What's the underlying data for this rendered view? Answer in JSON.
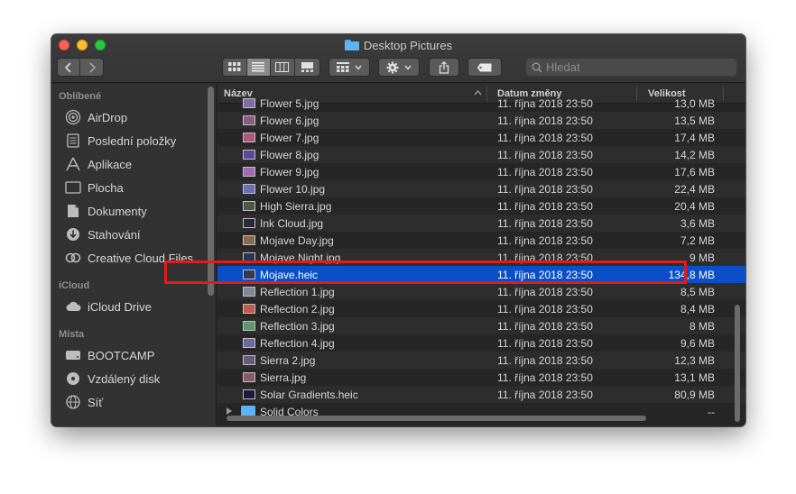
{
  "window": {
    "title": "Desktop Pictures"
  },
  "toolbar": {
    "back_icon": "chevron-left-icon",
    "forward_icon": "chevron-right-icon",
    "view_modes": [
      "icon-view",
      "list-view",
      "column-view",
      "gallery-view"
    ],
    "active_view": "list-view",
    "search_placeholder": "Hledat"
  },
  "sidebar": {
    "sections": [
      {
        "title": "Oblíbené",
        "items": [
          {
            "label": "AirDrop",
            "icon": "airdrop-icon"
          },
          {
            "label": "Poslední položky",
            "icon": "recents-icon"
          },
          {
            "label": "Aplikace",
            "icon": "applications-icon"
          },
          {
            "label": "Plocha",
            "icon": "desktop-icon"
          },
          {
            "label": "Dokumenty",
            "icon": "documents-icon"
          },
          {
            "label": "Stahování",
            "icon": "downloads-icon"
          },
          {
            "label": "Creative Cloud Files",
            "icon": "creative-cloud-icon"
          }
        ]
      },
      {
        "title": "iCloud",
        "items": [
          {
            "label": "iCloud Drive",
            "icon": "cloud-icon"
          }
        ]
      },
      {
        "title": "Místa",
        "items": [
          {
            "label": "BOOTCAMP",
            "icon": "disk-icon"
          },
          {
            "label": "Vzdálený disk",
            "icon": "remote-disc-icon"
          },
          {
            "label": "Síť",
            "icon": "network-icon"
          }
        ]
      }
    ]
  },
  "columns": {
    "name": "Název",
    "date": "Datum změny",
    "size": "Velikost"
  },
  "files": [
    {
      "name": "Flower 5.jpg",
      "date": "11. října 2018 23:50",
      "size": "13,0 MB",
      "thumb": "#7d6fa6"
    },
    {
      "name": "Flower 6.jpg",
      "date": "11. října 2018 23:50",
      "size": "13,5 MB",
      "thumb": "#8a5f7d"
    },
    {
      "name": "Flower 7.jpg",
      "date": "11. října 2018 23:50",
      "size": "17,4 MB",
      "thumb": "#b0577a"
    },
    {
      "name": "Flower 8.jpg",
      "date": "11. října 2018 23:50",
      "size": "14,2 MB",
      "thumb": "#5b4a9a"
    },
    {
      "name": "Flower 9.jpg",
      "date": "11. října 2018 23:50",
      "size": "17,6 MB",
      "thumb": "#a06ab0"
    },
    {
      "name": "Flower 10.jpg",
      "date": "11. října 2018 23:50",
      "size": "22,4 MB",
      "thumb": "#6d6db5"
    },
    {
      "name": "High Sierra.jpg",
      "date": "11. října 2018 23:50",
      "size": "20,4 MB",
      "thumb": "#4a5a4a"
    },
    {
      "name": "Ink Cloud.jpg",
      "date": "11. října 2018 23:50",
      "size": "3,6 MB",
      "thumb": "#2a2a3a"
    },
    {
      "name": "Mojave Day.jpg",
      "date": "11. října 2018 23:50",
      "size": "7,2 MB",
      "thumb": "#8a6a50"
    },
    {
      "name": "Mojave Night.jpg",
      "date": "11. října 2018 23:50",
      "size": "9 MB",
      "thumb": "#2a3550"
    },
    {
      "name": "Mojave.heic",
      "date": "11. října 2018 23:50",
      "size": "134,8 MB",
      "thumb": "#2f3a58",
      "selected": true
    },
    {
      "name": "Reflection 1.jpg",
      "date": "11. října 2018 23:50",
      "size": "8,5 MB",
      "thumb": "#7a8a9a"
    },
    {
      "name": "Reflection 2.jpg",
      "date": "11. října 2018 23:50",
      "size": "8,4 MB",
      "thumb": "#c05a4a"
    },
    {
      "name": "Reflection 3.jpg",
      "date": "11. října 2018 23:50",
      "size": "8 MB",
      "thumb": "#5a9a6a"
    },
    {
      "name": "Reflection 4.jpg",
      "date": "11. října 2018 23:50",
      "size": "9,6 MB",
      "thumb": "#6a6aa0"
    },
    {
      "name": "Sierra 2.jpg",
      "date": "11. října 2018 23:50",
      "size": "12,3 MB",
      "thumb": "#6a5a7a"
    },
    {
      "name": "Sierra.jpg",
      "date": "11. října 2018 23:50",
      "size": "13,1 MB",
      "thumb": "#8a5a6a"
    },
    {
      "name": "Solar Gradients.heic",
      "date": "11. října 2018 23:50",
      "size": "80,9 MB",
      "thumb": "#1a1a3a"
    },
    {
      "name": "Solid Colors",
      "date": "",
      "size": "--",
      "folder": true
    }
  ],
  "colors": {
    "selection": "#0a4fc7",
    "highlight_border": "#e21b1b"
  }
}
